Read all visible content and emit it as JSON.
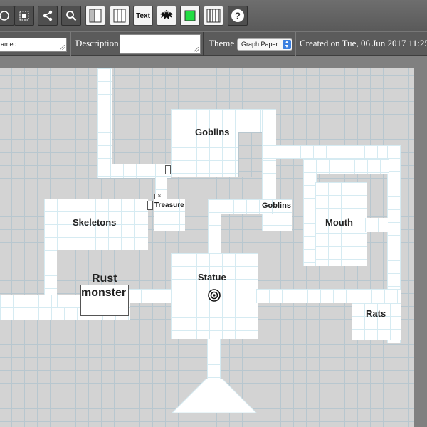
{
  "toolbar": {
    "tools": [
      {
        "id": "select",
        "icon": "circle-select-icon"
      },
      {
        "id": "marquee",
        "icon": "marquee-icon"
      },
      {
        "id": "share",
        "icon": "share-icon"
      },
      {
        "id": "zoom",
        "icon": "magnifier-icon"
      },
      {
        "id": "left-panel",
        "icon": "left-panel-icon"
      },
      {
        "id": "right-panel",
        "icon": "right-panel-icon"
      },
      {
        "id": "text",
        "icon": "text-icon",
        "label": "Text"
      },
      {
        "id": "monster",
        "icon": "dragon-icon"
      },
      {
        "id": "color",
        "icon": "color-swatch-icon",
        "color": "#22dd44"
      },
      {
        "id": "grid",
        "icon": "columns-icon"
      },
      {
        "id": "help",
        "icon": "help-icon",
        "label": "?"
      }
    ]
  },
  "properties": {
    "name_value": "amed",
    "description_label": "Description",
    "description_value": "",
    "theme_label": "Theme",
    "theme_selected": "Graph Paper",
    "created_text": "Created on Tue, 06 Jun 2017 11:25"
  },
  "map": {
    "secret_door_mark": "S",
    "rooms": {
      "goblins_north": "Goblins",
      "skeletons": "Skeletons",
      "treasure": "Treasure",
      "goblins_east": "Goblins",
      "mouth": "Mouth",
      "rust_monster_line1": "Rust",
      "rust_monster_line2": "monster",
      "statue": "Statue",
      "rats": "Rats"
    }
  },
  "colors": {
    "floor": "#ffffff",
    "rock": "#d3d3d3",
    "grid": "#b8c7cf",
    "toolbar": "#5f5f5f",
    "accent_select": "#3b7fe0"
  }
}
